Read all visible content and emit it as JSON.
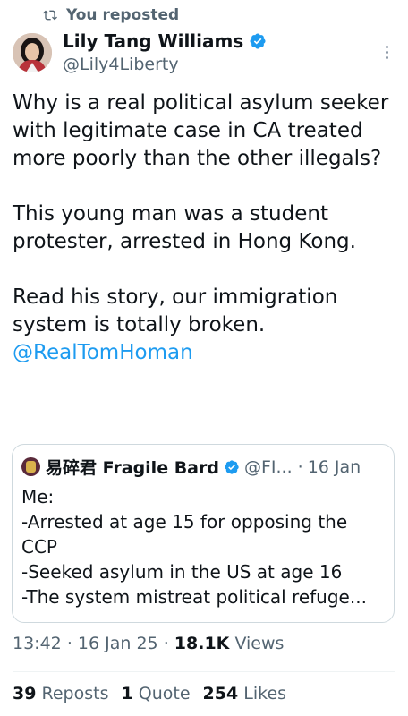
{
  "repost": {
    "label": "You reposted",
    "icon": "repost-icon"
  },
  "author": {
    "name": "Lily Tang Williams",
    "handle": "@Lily4Liberty",
    "avatar": "avatar",
    "verified_icon": "verified-badge-icon"
  },
  "tweet": {
    "paragraphs": [
      "Why is a real political asylum seeker with legitimate case in CA treated more poorly than the other illegals?",
      "This young man was a student protester, arrested in Hong Kong.",
      "Read his story, our immigration system is totally broken."
    ],
    "mention": "@RealTomHoman"
  },
  "quote": {
    "name": "易碎君 Fragile Bard",
    "handle": "@FI...",
    "separator": "·",
    "date": "16 Jan",
    "lines": [
      "Me:",
      "-Arrested at age 15 for opposing the",
      "CCP",
      "-Seeked asylum in the US at age 16",
      "-The system mistreat political refuge..."
    ]
  },
  "meta": {
    "time": "13:42",
    "date": "16 Jan 25",
    "separator": "·",
    "views_count": "18.1K",
    "views_label": "Views"
  },
  "stats": {
    "reposts_count": "39",
    "reposts_label": "Reposts",
    "quotes_count": "1",
    "quotes_label": "Quote",
    "likes_count": "254",
    "likes_label": "Likes"
  },
  "colors": {
    "link": "#1d9bf0",
    "secondary_text": "#536471",
    "primary_text": "#0f1419",
    "border": "#cfd9de"
  }
}
